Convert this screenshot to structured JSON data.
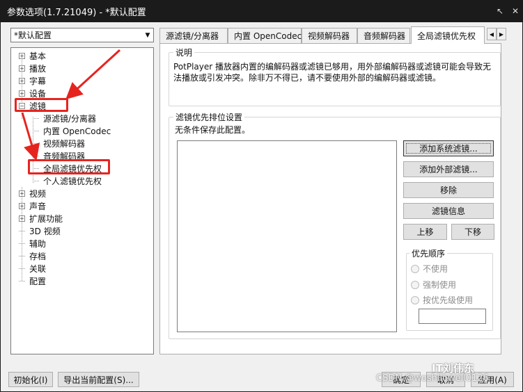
{
  "window": {
    "title": "参数选项(1.7.21049) - *默认配置",
    "pin_icon": "pin-icon",
    "close_icon": "close-icon"
  },
  "preset": {
    "value": "*默认配置"
  },
  "tree": {
    "items": [
      {
        "label": "基本"
      },
      {
        "label": "播放"
      },
      {
        "label": "字幕"
      },
      {
        "label": "设备"
      },
      {
        "label": "滤镜"
      },
      {
        "label": "源滤镜/分离器"
      },
      {
        "label": "内置 OpenCodec"
      },
      {
        "label": "视频解码器"
      },
      {
        "label": "音频解码器"
      },
      {
        "label": "全局滤镜优先权"
      },
      {
        "label": "个人滤镜优先权"
      },
      {
        "label": "视频"
      },
      {
        "label": "声音"
      },
      {
        "label": "扩展功能"
      },
      {
        "label": "3D 视频"
      },
      {
        "label": "辅助"
      },
      {
        "label": "存档"
      },
      {
        "label": "关联"
      },
      {
        "label": "配置"
      }
    ]
  },
  "tabs": [
    {
      "label": "源滤镜/分离器"
    },
    {
      "label": "内置 OpenCodec"
    },
    {
      "label": "视频解码器"
    },
    {
      "label": "音频解码器"
    },
    {
      "label": "全局滤镜优先权"
    }
  ],
  "description": {
    "title": "说明",
    "text": "PotPlayer 播放器内置的编解码器或滤镜已够用，用外部编解码器或滤镜可能会导致无法播放或引发冲突。除非万不得已，请不要使用外部的编解码器或滤镜。"
  },
  "priority": {
    "title": "滤镜优先排位设置",
    "note": "无条件保存此配置。",
    "buttons": {
      "add_system": "添加系统滤镜...",
      "add_external": "添加外部滤镜...",
      "remove": "移除",
      "info": "滤镜信息",
      "up": "上移",
      "down": "下移"
    },
    "order": {
      "title": "优先顺序",
      "options": [
        "不使用",
        "强制使用",
        "按优先级使用"
      ]
    }
  },
  "footer": {
    "init": "初始化(I)",
    "export": "导出当前配置(S)...",
    "confirm": "确定",
    "cancel": "取消",
    "apply": "应用(A)"
  },
  "watermark": {
    "brand": "IT刘伟东",
    "credit": "CSDN @woshilowell0126"
  },
  "annotation_color": "#e6241f"
}
